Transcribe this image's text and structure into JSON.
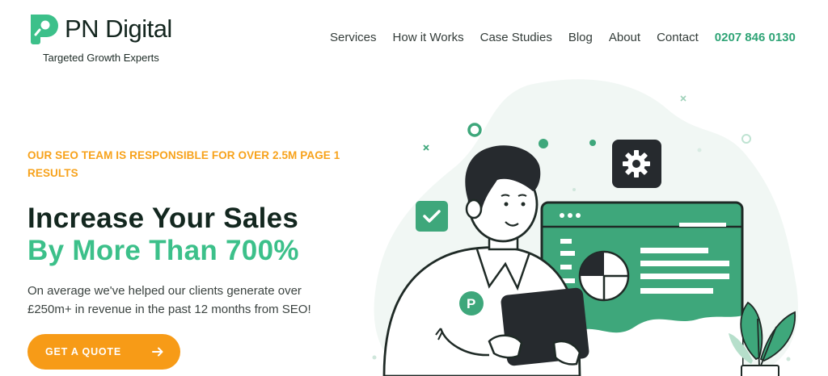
{
  "brand": {
    "name": "PN Digital",
    "tagline": "Targeted Growth Experts",
    "logo_letter": "P"
  },
  "nav": {
    "items": [
      {
        "label": "Services"
      },
      {
        "label": "How it Works"
      },
      {
        "label": "Case Studies"
      },
      {
        "label": "Blog"
      },
      {
        "label": "About"
      },
      {
        "label": "Contact"
      }
    ],
    "phone": "0207 846 0130"
  },
  "hero": {
    "kicker": "OUR SEO TEAM IS RESPONSIBLE FOR OVER 2.5M PAGE 1 RESULTS",
    "headline_line1": "Increase Your Sales",
    "headline_line2": "By More Than 700%",
    "description": "On average we've helped our clients generate over £250m+ in revenue in the past 12 months from SEO!",
    "cta_label": "GET A QUOTE"
  },
  "illustration": {
    "icons": [
      "checkmark-icon",
      "gear-icon",
      "pie-chart-icon",
      "arrow-right-icon"
    ]
  },
  "colors": {
    "brand_green": "#3cc08a",
    "dark_green": "#13271f",
    "accent_orange": "#f79b17",
    "kicker_orange": "#f7a21b",
    "illustration_green": "#3ea77b"
  }
}
